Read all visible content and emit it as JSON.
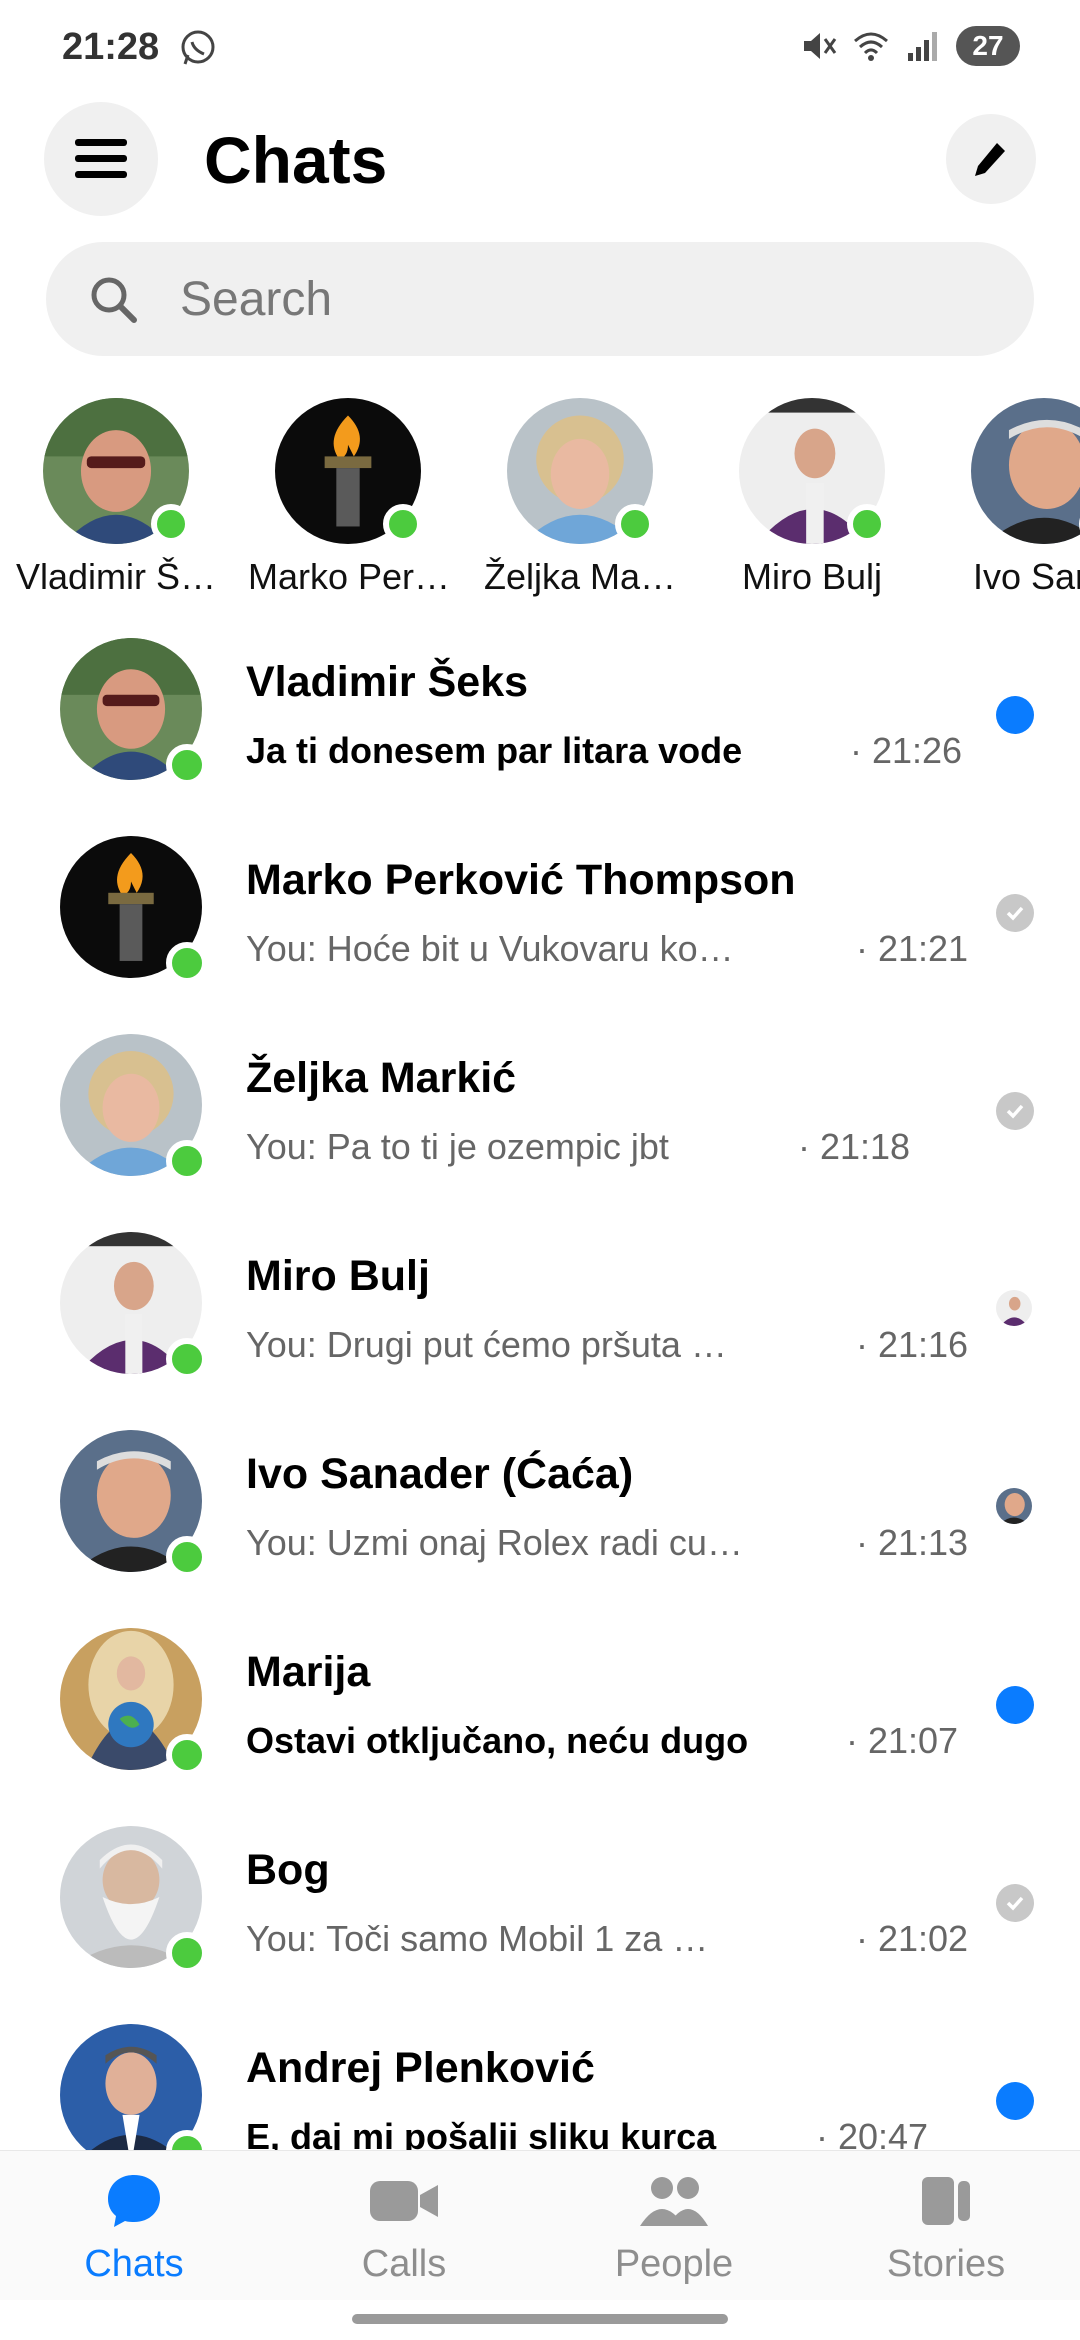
{
  "status_bar": {
    "time": "21:28",
    "battery": "27",
    "icons": [
      "whatsapp-icon",
      "mute-icon",
      "wifi-icon",
      "signal-icon"
    ]
  },
  "header": {
    "title": "Chats",
    "menu_icon": "hamburger-menu-icon",
    "compose_icon": "pencil-icon"
  },
  "search": {
    "placeholder": "Search"
  },
  "stories": [
    {
      "name": "Vladimir Š…",
      "online": true
    },
    {
      "name": "Marko Per…",
      "online": true
    },
    {
      "name": "Željka Ma…",
      "online": true
    },
    {
      "name": "Miro Bulj",
      "online": true
    },
    {
      "name": "Ivo Sana",
      "online": true
    }
  ],
  "chats": [
    {
      "name": "Vladimir Šeks",
      "preview": "Ja ti donesem par litara vode",
      "time": "· 21:26",
      "unread": true,
      "status": "unread-dot",
      "online": true
    },
    {
      "name": "Marko Perković Thompson",
      "preview": "You: Hoće bit u Vukovaru ko…",
      "time": "· 21:21",
      "unread": false,
      "status": "sent-check",
      "online": true
    },
    {
      "name": "Željka Markić",
      "preview": "You: Pa to ti je ozempic jbt",
      "time": "· 21:18",
      "unread": false,
      "status": "sent-check",
      "online": true
    },
    {
      "name": "Miro Bulj",
      "preview": "You: Drugi put ćemo pršuta …",
      "time": "· 21:16",
      "unread": false,
      "status": "seen-avatar",
      "online": true
    },
    {
      "name": "Ivo Sanader (Ćaća)",
      "preview": "You: Uzmi onaj Rolex radi cu…",
      "time": "· 21:13",
      "unread": false,
      "status": "seen-avatar",
      "online": true
    },
    {
      "name": "Marija",
      "preview": "Ostavi otključano, neću dugo",
      "time": "· 21:07",
      "unread": true,
      "status": "unread-dot",
      "online": true
    },
    {
      "name": "Bog",
      "preview": "You: Toči samo Mobil 1 za …",
      "time": "· 21:02",
      "unread": false,
      "status": "sent-check",
      "online": true
    },
    {
      "name": "Andrej Plenković",
      "preview": "E, daj mi pošalji sliku kurca",
      "time": "· 20:47",
      "unread": true,
      "status": "unread-dot",
      "online": true
    }
  ],
  "bottom_nav": [
    {
      "label": "Chats",
      "icon": "chat-bubble-icon",
      "active": true
    },
    {
      "label": "Calls",
      "icon": "video-camera-icon",
      "active": false
    },
    {
      "label": "People",
      "icon": "people-icon",
      "active": false
    },
    {
      "label": "Stories",
      "icon": "stories-icon",
      "active": false
    }
  ],
  "colors": {
    "accent": "#0a7cff",
    "online": "#4ccb3e",
    "muted_text": "#666666",
    "search_bg": "#f0f0f0"
  }
}
